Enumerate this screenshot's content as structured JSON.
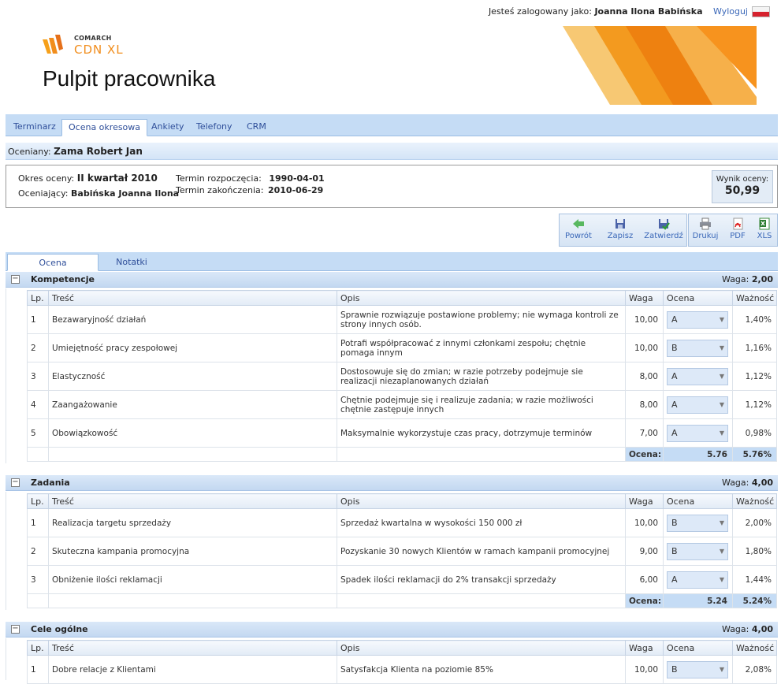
{
  "header": {
    "logged_in_prefix": "Jesteś zalogowany jako:",
    "user_name": "Joanna Ilona Babińska",
    "logout": "Wyloguj",
    "logo_brand": "COMARCH",
    "logo_product": "CDN XL",
    "page_title": "Pulpit pracownika"
  },
  "main_tabs": [
    "Terminarz",
    "Ocena okresowa",
    "Ankiety",
    "Telefony",
    "CRM"
  ],
  "evaluated": {
    "label": "Oceniany:",
    "name": "Zama Robert Jan"
  },
  "info": {
    "period_label": "Okres oceny:",
    "period_value": "II kwartał 2010",
    "evaluator_label": "Oceniający:",
    "evaluator_value": "Babińska Joanna Ilona",
    "start_label": "Termin rozpoczęcia:",
    "start_value": "1990-04-01",
    "end_label": "Termin zakończenia:",
    "end_value": "2010-06-29",
    "score_label": "Wynik oceny:",
    "score_value": "50,99"
  },
  "toolbar": {
    "back": "Powrót",
    "save": "Zapisz",
    "approve": "Zatwierdź",
    "print": "Drukuj",
    "pdf": "PDF",
    "xls": "XLS"
  },
  "sub_tabs": [
    "Ocena",
    "Notatki"
  ],
  "columns": [
    "Lp.",
    "Treść",
    "Opis",
    "Waga",
    "Ocena",
    "Ważność"
  ],
  "sections": [
    {
      "name": "Kompetencje",
      "weight_label": "Waga:",
      "weight": "2,00",
      "rows": [
        {
          "lp": "1",
          "tresc": "Bezawaryjność działań",
          "opis": "Sprawnie rozwiązuje postawione problemy; nie wymaga kontroli ze strony innych osób.",
          "waga": "10,00",
          "ocena": "A",
          "waznosc": "1,40%"
        },
        {
          "lp": "2",
          "tresc": "Umiejętność pracy zespołowej",
          "opis": "Potrafi współpracować z innymi członkami zespołu; chętnie pomaga innym",
          "waga": "10,00",
          "ocena": "B",
          "waznosc": "1,16%"
        },
        {
          "lp": "3",
          "tresc": "Elastyczność",
          "opis": "Dostosowuje się do zmian; w razie potrzeby podejmuje sie realizacji niezaplanowanych działań",
          "waga": "8,00",
          "ocena": "A",
          "waznosc": "1,12%"
        },
        {
          "lp": "4",
          "tresc": "Zaangażowanie",
          "opis": "Chętnie podejmuje się i realizuje zadania; w razie możliwości chętnie zastępuje innych",
          "waga": "8,00",
          "ocena": "A",
          "waznosc": "1,12%"
        },
        {
          "lp": "5",
          "tresc": "Obowiązkowość",
          "opis": "Maksymalnie wykorzystuje czas pracy, dotrzymuje terminów",
          "waga": "7,00",
          "ocena": "A",
          "waznosc": "0,98%"
        }
      ],
      "sum_label": "Ocena:",
      "sum_value": "5.76",
      "sum_pct": "5.76%"
    },
    {
      "name": "Zadania",
      "weight_label": "Waga:",
      "weight": "4,00",
      "rows": [
        {
          "lp": "1",
          "tresc": "Realizacja targetu sprzedaży",
          "opis": "Sprzedaż kwartalna w wysokości 150 000 zł",
          "waga": "10,00",
          "ocena": "B",
          "waznosc": "2,00%"
        },
        {
          "lp": "2",
          "tresc": "Skuteczna kampania promocyjna",
          "opis": "Pozyskanie 30 nowych Klientów w ramach kampanii promocyjnej",
          "waga": "9,00",
          "ocena": "B",
          "waznosc": "1,80%"
        },
        {
          "lp": "3",
          "tresc": "Obniżenie ilości reklamacji",
          "opis": "Spadek ilości reklamacji do 2% transakcji sprzedaży",
          "waga": "6,00",
          "ocena": "A",
          "waznosc": "1,44%"
        }
      ],
      "sum_label": "Ocena:",
      "sum_value": "5.24",
      "sum_pct": "5.24%"
    },
    {
      "name": "Cele ogólne",
      "weight_label": "Waga:",
      "weight": "4,00",
      "rows": [
        {
          "lp": "1",
          "tresc": "Dobre relacje z Klientami",
          "opis": "Satysfakcja Klienta na poziomie 85%",
          "waga": "10,00",
          "ocena": "B",
          "waznosc": "2,08%"
        }
      ]
    }
  ]
}
